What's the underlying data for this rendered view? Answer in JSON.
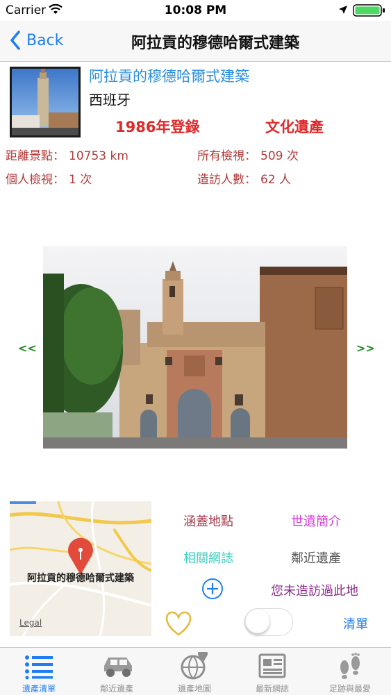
{
  "status_bar": {
    "carrier": "Carrier",
    "time": "10:08 PM"
  },
  "nav": {
    "back_label": "Back",
    "title": "阿拉貢的穆德哈爾式建築"
  },
  "site": {
    "title": "阿拉貢的穆德哈爾式建築",
    "country": "西班牙",
    "year": "1986年登錄",
    "type": "文化遺產"
  },
  "stats": {
    "distance_label": "距離景點：",
    "distance_value": "10753 km",
    "views_label": "所有檢視：",
    "views_value": "509 次",
    "personal_label": "個人檢視：",
    "personal_value": "1 次",
    "visitors_label": "造訪人數：",
    "visitors_value": "62 人"
  },
  "gallery": {
    "prev": "<<",
    "next": ">>"
  },
  "map": {
    "pin_label": "阿拉貢的穆德哈爾式建築",
    "legal": "Legal"
  },
  "actions": {
    "covered_places": "涵蓋地點",
    "intro": "世遺簡介",
    "related_blogs": "相關網誌",
    "nearby": "鄰近遺產",
    "not_visited": "您未造訪過此地",
    "list": "清單"
  },
  "tabs": [
    {
      "label": "遺產清單"
    },
    {
      "label": "鄰近遺產"
    },
    {
      "label": "遺產地圖"
    },
    {
      "label": "最新網誌"
    },
    {
      "label": "足跡與最愛"
    }
  ],
  "colors": {
    "accent": "#1e7cf5",
    "red": "#dd2a2a",
    "stat_red": "#b33a3a",
    "maroon": "#a8384a",
    "magenta": "#d63fd6",
    "teal": "#3ccfc0",
    "purple": "#8a2a8a",
    "heart": "#e3b93c",
    "pin": "#e24b3b"
  }
}
